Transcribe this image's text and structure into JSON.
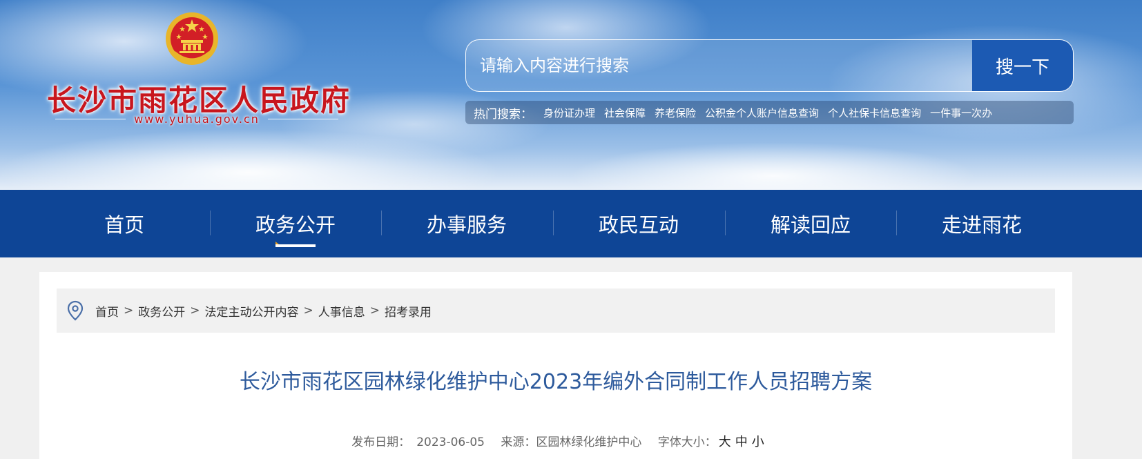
{
  "header": {
    "site_title": "长沙市雨花区人民政府",
    "site_url": "www.yuhua.gov.cn",
    "emblem_icon": "national-emblem-icon",
    "search": {
      "placeholder": "请输入内容进行搜索",
      "button_label": "搜一下"
    },
    "hot_search": {
      "label": "热门搜索：",
      "items": [
        "身份证办理",
        "社会保障",
        "养老保险",
        "公积金个人账户信息查询",
        "个人社保卡信息查询",
        "一件事一次办"
      ]
    }
  },
  "nav": {
    "items": [
      "首页",
      "政务公开",
      "办事服务",
      "政民互动",
      "解读回应",
      "走进雨花"
    ],
    "active": "政务公开"
  },
  "breadcrumb": {
    "icon": "location-pin-icon",
    "items": [
      "首页",
      "政务公开",
      "法定主动公开内容",
      "人事信息",
      "招考录用"
    ],
    "separator": ">"
  },
  "article": {
    "title": "长沙市雨花区园林绿化维护中心2023年编外合同制工作人员招聘方案",
    "meta": {
      "date_label": "发布日期：",
      "date": "2023-06-05",
      "source_label": "来源：",
      "source": "区园林绿化维护中心",
      "font_size_label": "字体大小：",
      "font_size_options": [
        "大",
        "中",
        "小"
      ]
    }
  },
  "colors": {
    "nav_bg": "#0e4596",
    "search_button": "#1c5ab3",
    "title_red": "#c8161d",
    "article_title": "#2d5a9c"
  }
}
